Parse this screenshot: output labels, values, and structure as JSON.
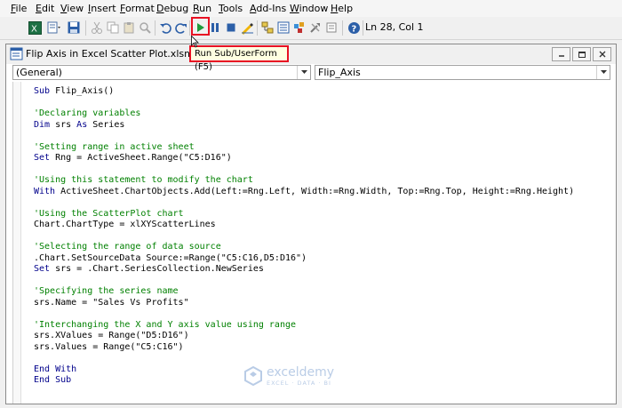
{
  "menu": [
    "File",
    "Edit",
    "View",
    "Insert",
    "Format",
    "Debug",
    "Run",
    "Tools",
    "Add-Ins",
    "Window",
    "Help"
  ],
  "toolbar": {
    "cursor_position": "Ln 28, Col 1"
  },
  "tooltip": "Run Sub/UserForm (F5)",
  "window": {
    "title": "Flip Axis in Excel Scatter Plot.xlsm - Module2"
  },
  "dropdowns": {
    "object": "(General)",
    "procedure": "Flip_Axis"
  },
  "code_lines": [
    "Sub Flip_Axis()",
    "",
    "'Declaring variables",
    "Dim srs As Series",
    "",
    "'Setting range in active sheet",
    "Set Rng = ActiveSheet.Range(\"C5:D16\")",
    "",
    "'Using this statement to modify the chart",
    "With ActiveSheet.ChartObjects.Add(Left:=Rng.Left, Width:=Rng.Width, Top:=Rng.Top, Height:=Rng.Height)",
    "",
    "'Using the ScatterPlot chart",
    "Chart.ChartType = xlXYScatterLines",
    "",
    "'Selecting the range of data source",
    ".Chart.SetSourceData Source:=Range(\"C5:C16,D5:D16\")",
    "Set srs = .Chart.SeriesCollection.NewSeries",
    "",
    "'Specifying the series name",
    "srs.Name = \"Sales Vs Profits\"",
    "",
    "'Interchanging the X and Y axis value using range",
    "srs.XValues = Range(\"D5:D16\")",
    "srs.Values = Range(\"C5:C16\")",
    "",
    "End With",
    "End Sub"
  ],
  "watermark": {
    "name": "exceldemy",
    "sub": "EXCEL · DATA · BI"
  },
  "colors": {
    "highlight": "#e81123",
    "comment": "#008000",
    "keyword": "#00008b"
  }
}
